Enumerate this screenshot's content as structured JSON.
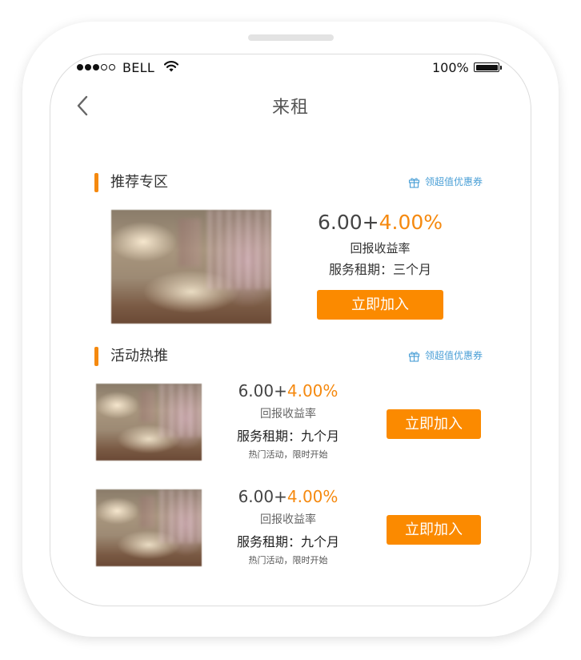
{
  "status_bar": {
    "signal_full": 3,
    "signal_empty": 2,
    "carrier": "BELL",
    "battery_percent": "100%"
  },
  "nav": {
    "title": "来租",
    "back_icon": "chevron-left-icon"
  },
  "recommended": {
    "section_title": "推荐专区",
    "coupon_label": "领超值优惠券",
    "item": {
      "rate_base": "6.00",
      "rate_plus": "+",
      "rate_bonus": "4.00%",
      "rate_label": "回报收益率",
      "term": "服务租期：三个月",
      "button_label": "立即加入"
    }
  },
  "hot": {
    "section_title": "活动热推",
    "coupon_label": "领超值优惠券",
    "items": [
      {
        "rate_base": "6.00",
        "rate_plus": "+",
        "rate_bonus": "4.00%",
        "rate_label": "回报收益率",
        "term": "服务租期：九个月",
        "note": "热门活动，限时开始",
        "button_label": "立即加入"
      },
      {
        "rate_base": "6.00",
        "rate_plus": "+",
        "rate_bonus": "4.00%",
        "rate_label": "回报收益率",
        "term": "服务租期：九个月",
        "note": "热门活动，限时开始",
        "button_label": "立即加入"
      }
    ]
  },
  "colors": {
    "accent": "#f5890f",
    "button": "#fb8a00",
    "link": "#4a9fd6",
    "text": "#333333"
  },
  "icons": {
    "gift": "gift-icon",
    "wifi": "wifi-icon",
    "battery": "battery-icon"
  }
}
